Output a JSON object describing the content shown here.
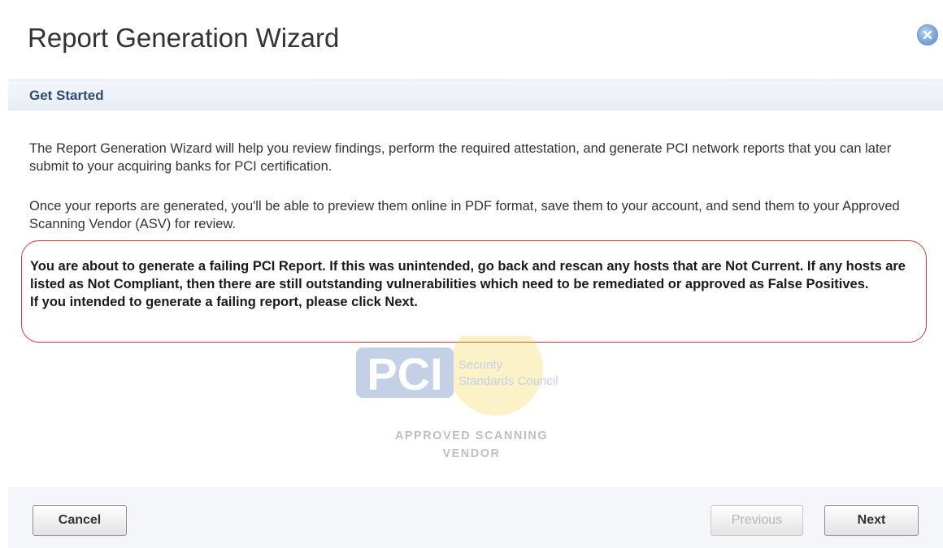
{
  "window": {
    "title": "Report Generation Wizard",
    "close_icon": "close-icon"
  },
  "section": {
    "title": "Get Started"
  },
  "content": {
    "paragraph1": "The Report Generation Wizard will help you review findings, perform the required attestation, and generate PCI network reports that you can later submit to your acquiring banks for PCI certification.",
    "paragraph2": "Once your reports are generated, you'll be able to preview them online in PDF format, save them to your account, and send them to your Approved Scanning Vendor (ASV) for review.",
    "warning_line1": "You are about to generate a failing PCI Report. If this was unintended, go back and rescan any hosts that are Not Current. If any hosts are listed as Not Compliant, then there are still outstanding vulnerabilities which need to be remediated or approved as False Positives.",
    "warning_line2": "If you intended to generate a failing report, please click Next."
  },
  "logo": {
    "mark": "PCI",
    "line1": "Security",
    "line2": "Standards Council",
    "caption_line1": "APPROVED SCANNING",
    "caption_line2": "VENDOR"
  },
  "buttons": {
    "cancel": "Cancel",
    "previous": "Previous",
    "next": "Next"
  },
  "colors": {
    "warning_border": "#d43a3a",
    "section_title": "#2f4c74",
    "close_button": "#7da7d9"
  }
}
